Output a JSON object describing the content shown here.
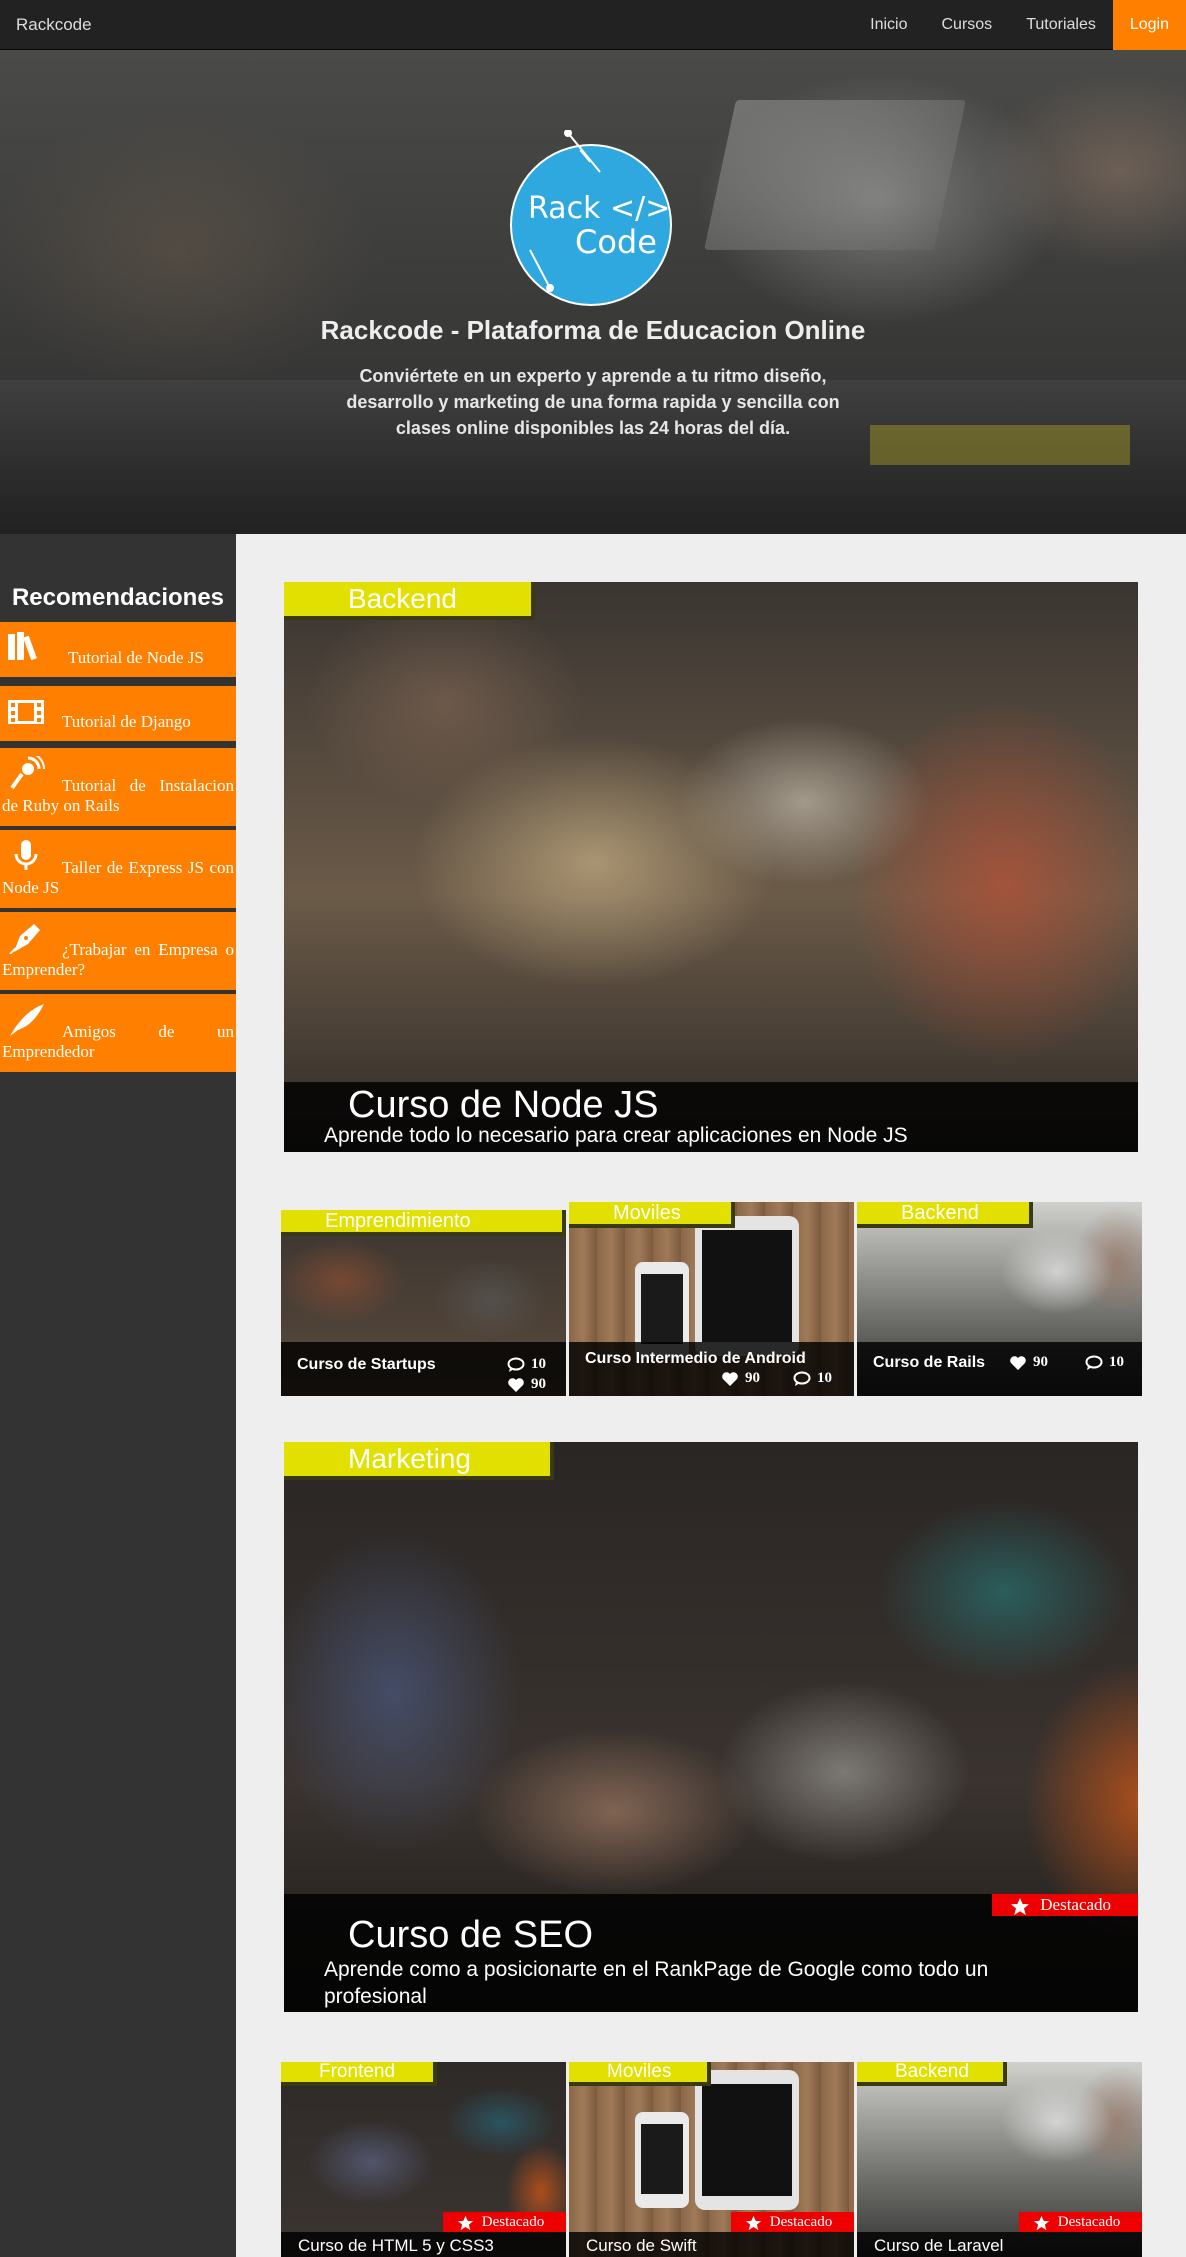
{
  "navbar": {
    "brand": "Rackcode",
    "links": [
      {
        "label": "Inicio"
      },
      {
        "label": "Cursos"
      },
      {
        "label": "Tutoriales"
      },
      {
        "label": "Login"
      }
    ]
  },
  "hero": {
    "logo_line1": "Rack </>",
    "logo_line2": "Code",
    "title": "Rackcode - Plataforma de Educacion Online",
    "text": "Conviértete en un experto y aprende a tu ritmo diseño, desarrollo y marketing de una forma rapida y sencilla con clases online disponibles las 24 horas del día."
  },
  "sidebar": {
    "title": "Recomendaciones",
    "items": [
      {
        "label": "Tutorial de Node JS",
        "icon": "books-icon"
      },
      {
        "label": "Tutorial de Django",
        "icon": "film-icon"
      },
      {
        "label": "Tutorial de Instalacion de Ruby on Rails",
        "icon": "podcast-icon"
      },
      {
        "label": "Taller de Express JS con Node JS",
        "icon": "microphone-icon"
      },
      {
        "label": "¿Trabajar en Empresa o Emprender?",
        "icon": "pen-icon"
      },
      {
        "label": "Amigos de un Emprendedor",
        "icon": "quill-icon"
      }
    ]
  },
  "featured_nodejs": {
    "category": "Backend",
    "title": "Curso de Node JS",
    "subtitle": "Aprende todo lo necesario para crear aplicaciones en Node JS"
  },
  "row1": [
    {
      "category": "Emprendimiento",
      "title": "Curso de Startups",
      "comments": "10",
      "likes": "90"
    },
    {
      "category": "Moviles",
      "title": "Curso Intermedio de Android",
      "likes": "90",
      "comments": "10"
    },
    {
      "category": "Backend",
      "title": "Curso de Rails",
      "likes": "90",
      "comments": "10"
    }
  ],
  "featured_seo": {
    "category": "Marketing",
    "badge": "Destacado",
    "title": "Curso de SEO",
    "subtitle": "Aprende como a posicionarte en el RankPage de Google como todo un profesional"
  },
  "row2": [
    {
      "category": "Frontend",
      "title": "Curso de HTML 5 y CSS3",
      "badge": "Destacado"
    },
    {
      "category": "Moviles",
      "title": "Curso de Swift",
      "badge": "Destacado"
    },
    {
      "category": "Backend",
      "title": "Curso de Laravel",
      "badge": "Destacado"
    }
  ],
  "colors": {
    "accent": "#ff8000",
    "category": "#e1e000",
    "badge": "#ee0000",
    "navbar": "#222222",
    "logo": "#2fa8e0"
  }
}
